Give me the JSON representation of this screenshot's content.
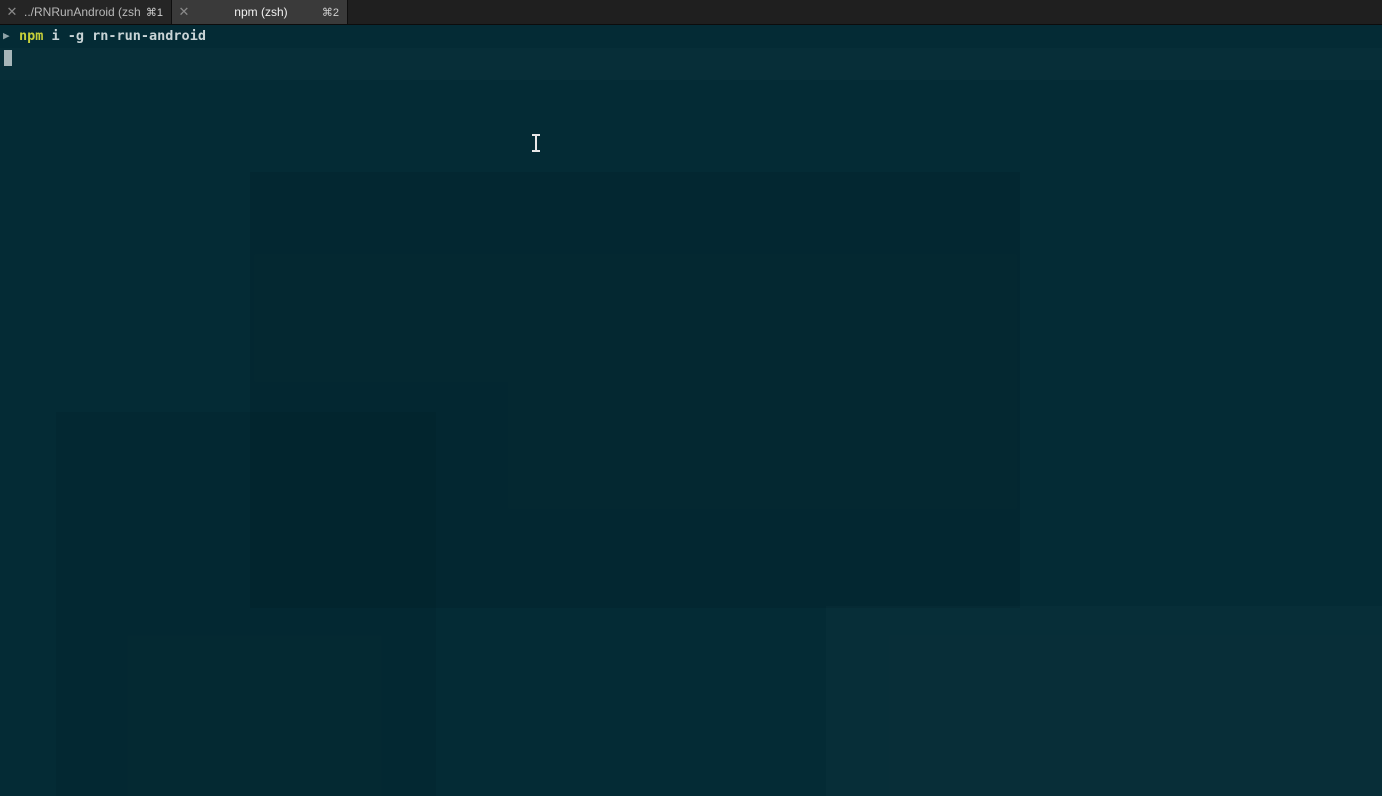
{
  "tabs": [
    {
      "title": "../RNRunAndroid (zsh)",
      "shortcut": "⌘1",
      "close_icon": "close-icon",
      "active": false
    },
    {
      "title": "npm (zsh)",
      "shortcut": "⌘2",
      "close_icon": "close-icon",
      "active": true
    }
  ],
  "terminal": {
    "prompt_symbol": "▶",
    "command": "npm",
    "arguments": " i -g rn-run-android"
  },
  "colors": {
    "background": "#042b35",
    "command_highlight": "#c6d03a",
    "tabbar": "#1e1e1e"
  }
}
